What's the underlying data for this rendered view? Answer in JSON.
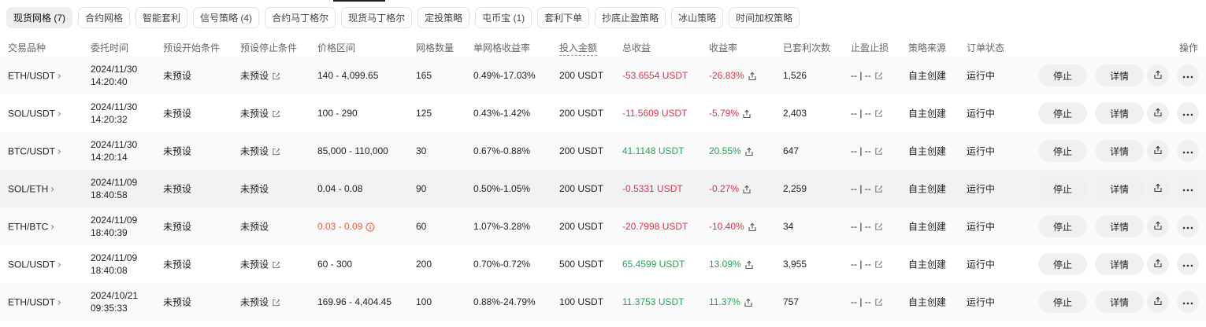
{
  "tabs": [
    {
      "label": "现货网格 (7)",
      "active": true
    },
    {
      "label": "合约网格"
    },
    {
      "label": "智能套利"
    },
    {
      "label": "信号策略 (4)"
    },
    {
      "label": "合约马丁格尔"
    },
    {
      "label": "现货马丁格尔"
    },
    {
      "label": "定投策略"
    },
    {
      "label": "屯币宝 (1)"
    },
    {
      "label": "套利下单"
    },
    {
      "label": "抄底止盈策略"
    },
    {
      "label": "冰山策略"
    },
    {
      "label": "时间加权策略"
    }
  ],
  "columns": {
    "pair": "交易品种",
    "time": "委托时间",
    "start": "预设开始条件",
    "stop": "预设停止条件",
    "range": "价格区间",
    "grids": "网格数量",
    "grid_yield": "单网格收益率",
    "invest": "投入金额",
    "total_profit": "总收益",
    "yield": "收益率",
    "arb_count": "已套利次数",
    "tpsl": "止盈止损",
    "source": "策略来源",
    "status": "订单状态",
    "actions": "操作"
  },
  "buttons": {
    "stop": "停止",
    "detail": "详情"
  },
  "rows": [
    {
      "pair": "ETH/USDT",
      "date": "2024/11/30",
      "clock": "14:20:40",
      "start": "未预设",
      "stop": "未预设",
      "stop_editable": true,
      "range": "140 - 4,099.65",
      "range_warn": false,
      "grids": "165",
      "grid_yield": "0.49%-17.03%",
      "invest": "200 USDT",
      "profit": "-53.6554 USDT",
      "yield": "-26.83%",
      "trend": "down",
      "arb": "1,526",
      "tpsl": "-- | --",
      "source": "自主创建",
      "status": "运行中"
    },
    {
      "pair": "SOL/USDT",
      "date": "2024/11/30",
      "clock": "14:20:32",
      "start": "未预设",
      "stop": "未预设",
      "stop_editable": true,
      "range": "100 - 290",
      "range_warn": false,
      "grids": "125",
      "grid_yield": "0.43%-1.42%",
      "invest": "200 USDT",
      "profit": "-11.5609 USDT",
      "yield": "-5.79%",
      "trend": "down",
      "arb": "2,403",
      "tpsl": "-- | --",
      "source": "自主创建",
      "status": "运行中"
    },
    {
      "pair": "BTC/USDT",
      "date": "2024/11/30",
      "clock": "14:20:14",
      "start": "未预设",
      "stop": "未预设",
      "stop_editable": true,
      "range": "85,000 - 110,000",
      "range_warn": false,
      "grids": "30",
      "grid_yield": "0.67%-0.88%",
      "invest": "200 USDT",
      "profit": "41.1148 USDT",
      "yield": "20.55%",
      "trend": "up",
      "arb": "647",
      "tpsl": "-- | --",
      "source": "自主创建",
      "status": "运行中"
    },
    {
      "pair": "SOL/ETH",
      "date": "2024/11/09",
      "clock": "18:40:58",
      "start": "未预设",
      "stop": "未预设",
      "stop_editable": false,
      "range": "0.04 - 0.08",
      "range_warn": false,
      "grids": "90",
      "grid_yield": "0.50%-1.05%",
      "invest": "200 USDT",
      "profit": "-0.5331 USDT",
      "yield": "-0.27%",
      "trend": "down",
      "arb": "2,259",
      "tpsl": "-- | --",
      "source": "自主创建",
      "status": "运行中"
    },
    {
      "pair": "ETH/BTC",
      "date": "2024/11/09",
      "clock": "18:40:39",
      "start": "未预设",
      "stop": "未预设",
      "stop_editable": false,
      "range": "0.03 - 0.09",
      "range_warn": true,
      "grids": "60",
      "grid_yield": "1.07%-3.28%",
      "invest": "200 USDT",
      "profit": "-20.7998 USDT",
      "yield": "-10.40%",
      "trend": "down",
      "arb": "34",
      "tpsl": "-- | --",
      "source": "自主创建",
      "status": "运行中"
    },
    {
      "pair": "SOL/USDT",
      "date": "2024/11/09",
      "clock": "18:40:08",
      "start": "未预设",
      "stop": "未预设",
      "stop_editable": true,
      "range": "60 - 300",
      "range_warn": false,
      "grids": "200",
      "grid_yield": "0.70%-0.72%",
      "invest": "500 USDT",
      "profit": "65.4599 USDT",
      "yield": "13.09%",
      "trend": "up",
      "arb": "3,955",
      "tpsl": "-- | --",
      "source": "自主创建",
      "status": "运行中"
    },
    {
      "pair": "ETH/USDT",
      "date": "2024/10/21",
      "clock": "09:35:33",
      "start": "未预设",
      "stop": "未预设",
      "stop_editable": true,
      "range": "169.96 - 4,404.45",
      "range_warn": false,
      "grids": "100",
      "grid_yield": "0.88%-24.79%",
      "invest": "100 USDT",
      "profit": "11.3753 USDT",
      "yield": "11.37%",
      "trend": "up",
      "arb": "757",
      "tpsl": "-- | --",
      "source": "自主创建",
      "status": "运行中"
    }
  ],
  "colors": {
    "negative": "#e1304a",
    "positive": "#1fa855",
    "warning": "#ef5a3c"
  }
}
